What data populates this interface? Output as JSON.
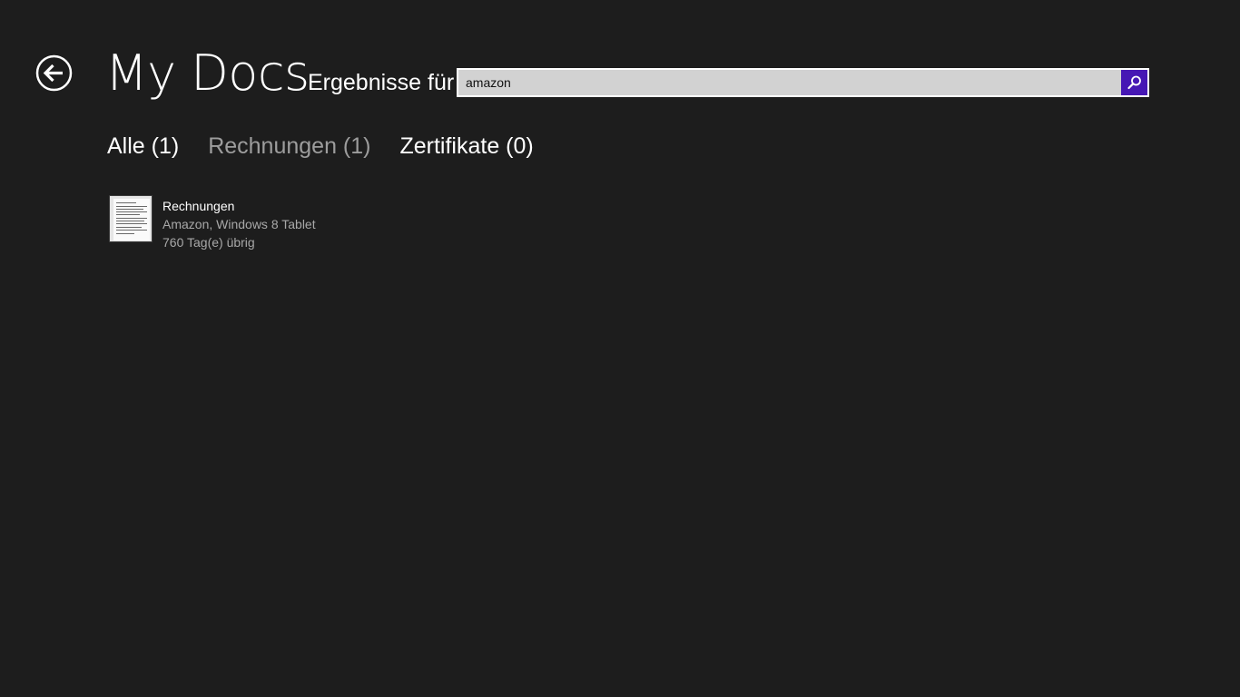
{
  "header": {
    "app_title": "My Docs",
    "results_label": "Ergebnisse für",
    "search": {
      "value": "amazon",
      "placeholder": ""
    }
  },
  "filters": [
    {
      "label": "Alle (1)",
      "state": "default"
    },
    {
      "label": "Rechnungen (1)",
      "state": "selected"
    },
    {
      "label": "Zertifikate (0)",
      "state": "default"
    }
  ],
  "results": [
    {
      "title": "Rechnungen",
      "subtitle": "Amazon, Windows 8 Tablet",
      "detail": "760 Tag(e) übrig"
    }
  ],
  "colors": {
    "background": "#1d1d1d",
    "accent": "#4617b4",
    "search_field": "#d2d2d2",
    "muted_text": "#9d9d9d"
  },
  "icons": {
    "back": "back-arrow-circle-icon",
    "search": "magnifier-icon",
    "document": "document-thumbnail-icon"
  }
}
